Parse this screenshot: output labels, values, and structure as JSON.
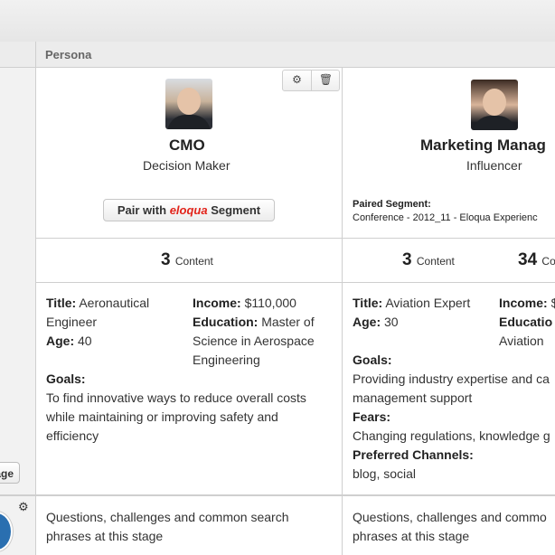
{
  "header": {
    "persona_label": "Persona"
  },
  "left": {
    "stage_button": "age"
  },
  "personas": [
    {
      "name": "CMO",
      "role": "Decision Maker",
      "pair_button": {
        "prefix": "Pair with",
        "brand": "eloqua",
        "suffix": "Segment"
      },
      "content_count": "3",
      "content_unit": "Content",
      "title_label": "Title:",
      "title_line1": "Aeronautical",
      "title_line2": "Engineer",
      "age_label": "Age:",
      "age": "40",
      "income_label": "Income:",
      "income": "$110,000",
      "education_label": "Education:",
      "education_line1": "Master of",
      "education_line2": "Science in Aerospace",
      "education_line3": "Engineering",
      "goals_label": "Goals:",
      "goals_line1": "To find innovative ways to reduce overall costs",
      "goals_line2": "while maintaining or improving safety and",
      "goals_line3": "efficiency",
      "stage_line1": "Questions, challenges and common search",
      "stage_line2": "phrases at this stage"
    },
    {
      "name": "Marketing Manag",
      "role": "Influencer",
      "paired_segment_label": "Paired Segment:",
      "paired_segment_value": "Conference - 2012_11 - Eloqua Experienc",
      "content_count": "3",
      "content_unit": "Content",
      "content_count2": "34",
      "content_unit2": "Co",
      "title_label": "Title:",
      "title": "Aviation Expert",
      "age_label": "Age:",
      "age": "30",
      "income_label": "Income:",
      "income": "$",
      "education_label": "Educatio",
      "education_line2": "Aviation",
      "goals_label": "Goals:",
      "goals_line1": "Providing industry expertise and ca",
      "goals_line2": "management support",
      "fears_label": "Fears:",
      "fears": "Changing regulations, knowledge g",
      "channels_label": "Preferred Channels:",
      "channels": "blog, social",
      "stage_line1": "Questions, challenges and commo",
      "stage_line2": "phrases at this stage"
    }
  ]
}
